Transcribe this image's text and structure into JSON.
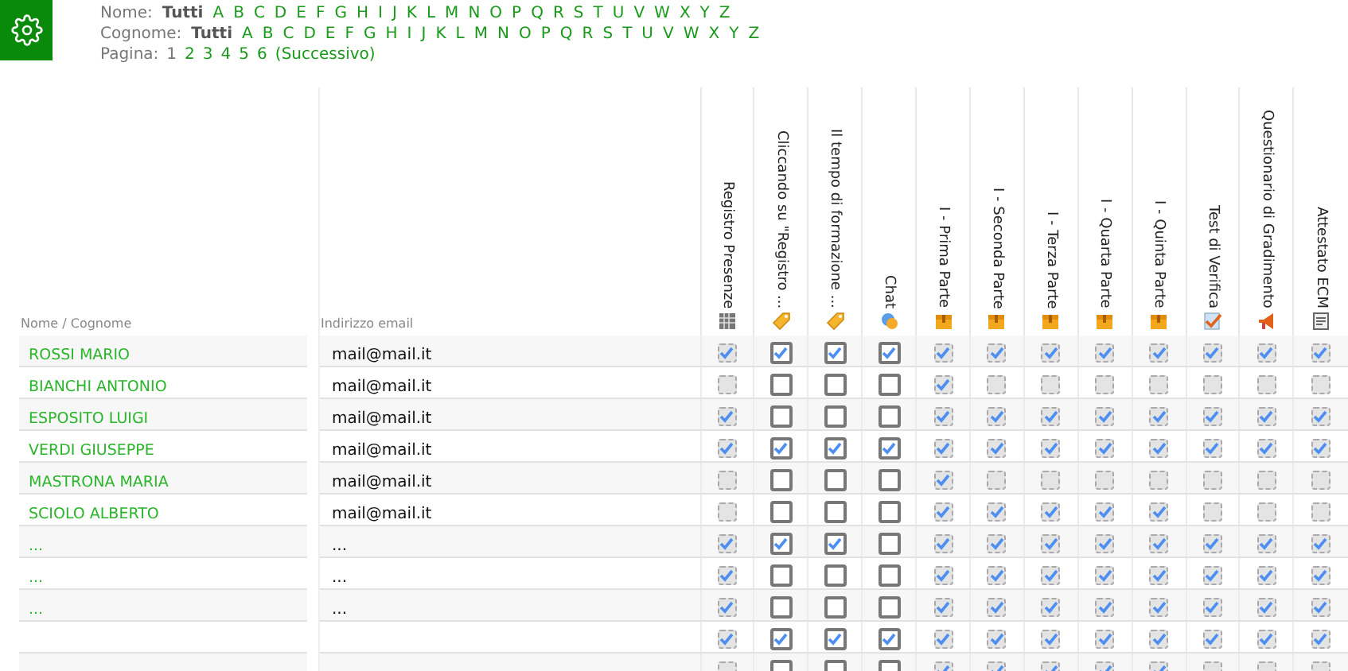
{
  "filters": [
    {
      "label": "Nome:",
      "options": [
        {
          "text": "Tutti",
          "selected": true
        },
        {
          "text": "A",
          "selected": false
        },
        {
          "text": "B",
          "selected": false
        },
        {
          "text": "C",
          "selected": false
        },
        {
          "text": "D",
          "selected": false
        },
        {
          "text": "E",
          "selected": false
        },
        {
          "text": "F",
          "selected": false
        },
        {
          "text": "G",
          "selected": false
        },
        {
          "text": "H",
          "selected": false
        },
        {
          "text": "I",
          "selected": false
        },
        {
          "text": "J",
          "selected": false
        },
        {
          "text": "K",
          "selected": false
        },
        {
          "text": "L",
          "selected": false
        },
        {
          "text": "M",
          "selected": false
        },
        {
          "text": "N",
          "selected": false
        },
        {
          "text": "O",
          "selected": false
        },
        {
          "text": "P",
          "selected": false
        },
        {
          "text": "Q",
          "selected": false
        },
        {
          "text": "R",
          "selected": false
        },
        {
          "text": "S",
          "selected": false
        },
        {
          "text": "T",
          "selected": false
        },
        {
          "text": "U",
          "selected": false
        },
        {
          "text": "V",
          "selected": false
        },
        {
          "text": "W",
          "selected": false
        },
        {
          "text": "X",
          "selected": false
        },
        {
          "text": "Y",
          "selected": false
        },
        {
          "text": "Z",
          "selected": false
        }
      ]
    },
    {
      "label": "Cognome:",
      "options": [
        {
          "text": "Tutti",
          "selected": true
        },
        {
          "text": "A",
          "selected": false
        },
        {
          "text": "B",
          "selected": false
        },
        {
          "text": "C",
          "selected": false
        },
        {
          "text": "D",
          "selected": false
        },
        {
          "text": "E",
          "selected": false
        },
        {
          "text": "F",
          "selected": false
        },
        {
          "text": "G",
          "selected": false
        },
        {
          "text": "H",
          "selected": false
        },
        {
          "text": "I",
          "selected": false
        },
        {
          "text": "J",
          "selected": false
        },
        {
          "text": "K",
          "selected": false
        },
        {
          "text": "L",
          "selected": false
        },
        {
          "text": "M",
          "selected": false
        },
        {
          "text": "N",
          "selected": false
        },
        {
          "text": "O",
          "selected": false
        },
        {
          "text": "P",
          "selected": false
        },
        {
          "text": "Q",
          "selected": false
        },
        {
          "text": "R",
          "selected": false
        },
        {
          "text": "S",
          "selected": false
        },
        {
          "text": "T",
          "selected": false
        },
        {
          "text": "U",
          "selected": false
        },
        {
          "text": "V",
          "selected": false
        },
        {
          "text": "W",
          "selected": false
        },
        {
          "text": "X",
          "selected": false
        },
        {
          "text": "Y",
          "selected": false
        },
        {
          "text": "Z",
          "selected": false
        }
      ]
    }
  ],
  "pagination": {
    "label": "Pagina:",
    "pages": [
      {
        "text": "1",
        "selected": true
      },
      {
        "text": "2",
        "selected": false
      },
      {
        "text": "3",
        "selected": false
      },
      {
        "text": "4",
        "selected": false
      },
      {
        "text": "5",
        "selected": false
      },
      {
        "text": "6",
        "selected": false
      }
    ],
    "next": "(Successivo)"
  },
  "table": {
    "name_header": "Nome / Cognome",
    "email_header": "Indirizzo email",
    "columns": [
      {
        "label": "Registro Presenze",
        "kind": "register",
        "disabled": true
      },
      {
        "label": "Cliccando su \"Registro ...",
        "kind": "attendance",
        "disabled": false
      },
      {
        "label": "Il tempo di formazione ...",
        "kind": "attendance",
        "disabled": false
      },
      {
        "label": "Chat",
        "kind": "chat",
        "disabled": false
      },
      {
        "label": "I - Prima Parte",
        "kind": "module",
        "disabled": true
      },
      {
        "label": "I - Seconda Parte",
        "kind": "module",
        "disabled": true
      },
      {
        "label": "I - Terza Parte",
        "kind": "module",
        "disabled": true
      },
      {
        "label": "I - Quarta Parte",
        "kind": "module",
        "disabled": true
      },
      {
        "label": "I - Quinta Parte",
        "kind": "module",
        "disabled": true
      },
      {
        "label": "Test di Verifica",
        "kind": "test",
        "disabled": true
      },
      {
        "label": "Questionario di Gradimento",
        "kind": "survey",
        "disabled": true
      },
      {
        "label": "Attestato ECM",
        "kind": "certificate",
        "disabled": true
      }
    ],
    "rows": [
      {
        "name": "ROSSI MARIO",
        "email": "mail@mail.it",
        "checks": [
          true,
          true,
          true,
          true,
          true,
          true,
          true,
          true,
          true,
          true,
          true,
          true
        ]
      },
      {
        "name": "BIANCHI ANTONIO",
        "email": "mail@mail.it",
        "checks": [
          false,
          false,
          false,
          false,
          true,
          false,
          false,
          false,
          false,
          false,
          false,
          false
        ]
      },
      {
        "name": "ESPOSITO LUIGI",
        "email": "mail@mail.it",
        "checks": [
          true,
          false,
          false,
          false,
          true,
          true,
          true,
          true,
          true,
          true,
          true,
          true
        ]
      },
      {
        "name": "VERDI GIUSEPPE",
        "email": "mail@mail.it",
        "checks": [
          true,
          true,
          true,
          true,
          true,
          true,
          true,
          true,
          true,
          true,
          true,
          true
        ]
      },
      {
        "name": "MASTRONA MARIA",
        "email": "mail@mail.it",
        "checks": [
          false,
          false,
          false,
          false,
          true,
          false,
          false,
          false,
          false,
          false,
          false,
          false
        ]
      },
      {
        "name": "SCIOLO ALBERTO",
        "email": "mail@mail.it",
        "checks": [
          false,
          false,
          false,
          false,
          true,
          true,
          true,
          true,
          true,
          false,
          false,
          false
        ]
      },
      {
        "name": "...",
        "email": "...",
        "checks": [
          true,
          true,
          true,
          false,
          true,
          true,
          true,
          true,
          true,
          true,
          true,
          true
        ]
      },
      {
        "name": "...",
        "email": "...",
        "checks": [
          true,
          false,
          false,
          false,
          true,
          true,
          true,
          true,
          true,
          true,
          true,
          true
        ]
      },
      {
        "name": "...",
        "email": "...",
        "checks": [
          true,
          false,
          false,
          false,
          true,
          true,
          true,
          true,
          true,
          true,
          true,
          true
        ]
      },
      {
        "checks": [
          true,
          true,
          true,
          true,
          true,
          true,
          true,
          true,
          true,
          true,
          true,
          true
        ]
      },
      {
        "checks": [
          false,
          false,
          false,
          false,
          true,
          true,
          true,
          true,
          true,
          false,
          false,
          false
        ]
      }
    ]
  }
}
